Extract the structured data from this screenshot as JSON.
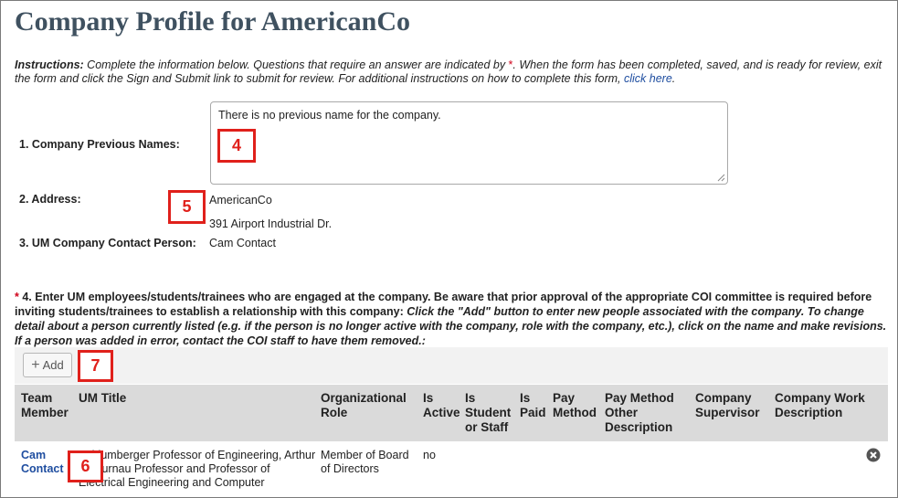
{
  "page": {
    "title": "Company Profile for AmericanCo"
  },
  "instructions": {
    "lead": "Instructions:",
    "text_before_asterisk": " Complete the information below.  Questions that require an answer are indicated by ",
    "asterisk": "*",
    "text_after_asterisk": ".  When the form has been completed, saved, and is ready for review, exit the form and click the Sign and Submit link to submit for review.  For additional instructions on how to complete this form, ",
    "link": "click here",
    "end": "."
  },
  "q1": {
    "label": "1. Company Previous Names:",
    "value": "There is no previous name for the company."
  },
  "q2": {
    "label": "2. Address:",
    "line1": "AmericanCo",
    "line2": "391 Airport Industrial Dr."
  },
  "q3": {
    "label": "3. UM Company Contact Person:",
    "value": "Cam Contact"
  },
  "q4": {
    "asterisk": "*",
    "text_bold": " 4.  Enter UM employees/students/trainees who are engaged at the company.  Be aware that prior approval of the appropriate COI committee is required before inviting students/trainees to establish a relationship with this company: ",
    "text_italic": "Click the \"Add\" button to enter new people associated with the company.  To change detail about a person currently listed (e.g. if the person is no longer active with the company, role with the company, etc.), click on the name and make revisions.  If a person was added in error, contact the COI staff to have them removed.:"
  },
  "toolbar": {
    "add_label": "Add"
  },
  "table": {
    "headers": {
      "team_member": "Team Member",
      "um_title": "UM Title",
      "org_role": "Organizational Role",
      "is_active": "Is Active",
      "is_student": "Is Student or Staff",
      "is_paid": "Is Paid",
      "pay_method": "Pay Method",
      "pay_method_other": "Pay Method Other Description",
      "company_supervisor": "Company Supervisor",
      "company_work": "Company Work Description"
    },
    "rows": [
      {
        "team_member": "Cam Contact",
        "um_title": "Schlumberger Professor of Engineering, Arthur F Thurnau Professor and Professor of Electrical Engineering and Computer",
        "org_role": "Member of Board of Directors",
        "is_active": "no",
        "is_student": "",
        "is_paid": "",
        "pay_method": "",
        "pay_method_other": "",
        "company_supervisor": "",
        "company_work": ""
      }
    ]
  },
  "callouts": {
    "c4": "4",
    "c5": "5",
    "c6": "6",
    "c7": "7"
  },
  "colors": {
    "title": "#3f5160",
    "link": "#1f4ea0",
    "required": "#d0021b",
    "callout": "#e0201b",
    "header_bg": "#dadada"
  }
}
